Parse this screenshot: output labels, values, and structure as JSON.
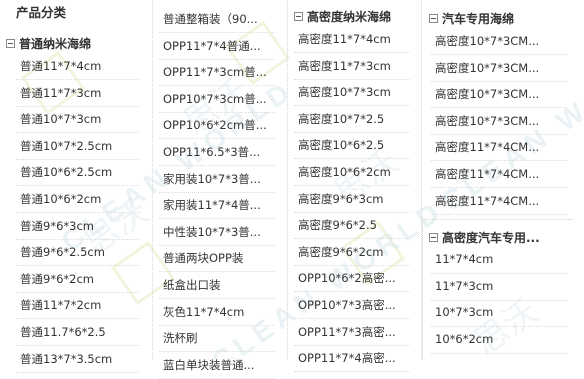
{
  "heading": "产品分类",
  "columns": [
    {
      "title": "普通纳米海绵",
      "items": [
        "普通11*7*4cm",
        "普通11*7*3cm",
        "普通10*7*3cm",
        "普通10*7*2.5cm",
        "普通10*6*2.5cm",
        "普通10*6*2cm",
        "普通9*6*3cm",
        "普通9*6*2.5cm",
        "普通9*6*2cm",
        "普通11*7*2cm",
        "普通11.7*6*2.5",
        "普通13*7*3.5cm"
      ]
    },
    {
      "title": "",
      "items": [
        "普通整箱装（90...",
        "OPP11*7*4普通...",
        "OPP11*7*3cm普...",
        "OPP10*7*3cm普...",
        "OPP10*6*2cm普...",
        "OPP11*6.5*3普...",
        "家用装10*7*3普...",
        "家用装11*7*4普...",
        "中性装10*7*3普...",
        "普通两块OPP装",
        "纸盒出口装",
        "灰色11*7*4cm",
        "洗杯刷",
        "蓝白单块装普通..."
      ]
    },
    {
      "title": "高密度纳米海绵",
      "items": [
        "高密度11*7*4cm",
        "高密度11*7*3cm",
        "高密度10*7*3cm",
        "高密度10*7*2.5",
        "高密度10*6*2.5",
        "高密度10*6*2cm",
        "高密度9*6*3cm",
        "高密度9*6*2.5",
        "高密度9*6*2cm",
        "OPP10*6*2高密...",
        "OPP10*7*3高密...",
        "OPP11*7*3高密...",
        "OPP11*7*4高密..."
      ]
    },
    {
      "title": "汽车专用海绵",
      "items": [
        "高密度10*7*3CM...",
        "高密度10*7*3CM...",
        "高密度10*7*3CM...",
        "高密度10*7*3CM...",
        "高密度11*7*4CM...",
        "高密度11*7*4CM...",
        "高密度11*7*4CM..."
      ]
    },
    {
      "title": "高密度汽车专用...",
      "items": [
        "11*7*4cm",
        "11*7*3cm",
        "10*7*3cm",
        "10*6*2cm"
      ]
    }
  ],
  "watermark": {
    "text": "CLEAN WORLD",
    "cn": "思沃"
  }
}
